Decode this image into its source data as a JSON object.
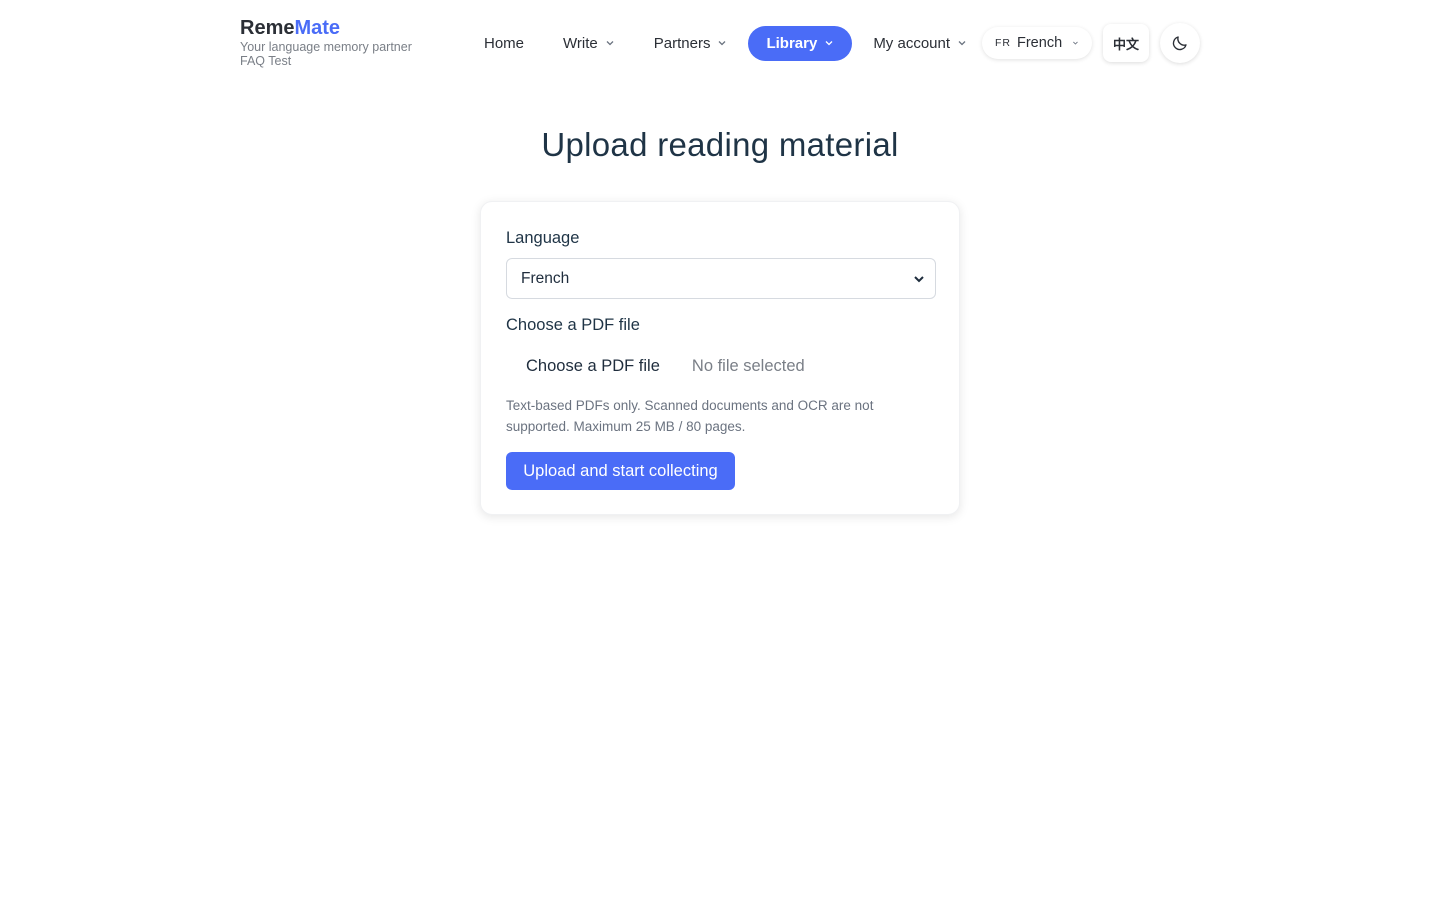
{
  "brand": {
    "name_part1": "Reme",
    "name_part2": "Mate",
    "tagline": "Your language memory partner",
    "user": "FAQ Test"
  },
  "nav": {
    "items": [
      {
        "label": "Home",
        "has_dropdown": false,
        "active": false
      },
      {
        "label": "Write",
        "has_dropdown": true,
        "active": false
      },
      {
        "label": "Partners",
        "has_dropdown": true,
        "active": false
      },
      {
        "label": "Library",
        "has_dropdown": true,
        "active": true
      },
      {
        "label": "My account",
        "has_dropdown": true,
        "active": false
      }
    ]
  },
  "language_switcher": {
    "code": "FR",
    "label": "French"
  },
  "ui_language_button": "中文",
  "theme_toggle_icon": "moon-icon",
  "page": {
    "title": "Upload reading material"
  },
  "form": {
    "language_label": "Language",
    "language_value": "French",
    "file_label": "Choose a PDF file",
    "file_button": "Choose a PDF file",
    "file_status": "No file selected",
    "hint": "Text-based PDFs only. Scanned documents and OCR are not supported. Maximum 25 MB / 80 pages.",
    "submit_label": "Upload and start collecting"
  },
  "colors": {
    "accent": "#4a6cf7",
    "text": "#1f3446",
    "muted": "#7a7f87"
  }
}
